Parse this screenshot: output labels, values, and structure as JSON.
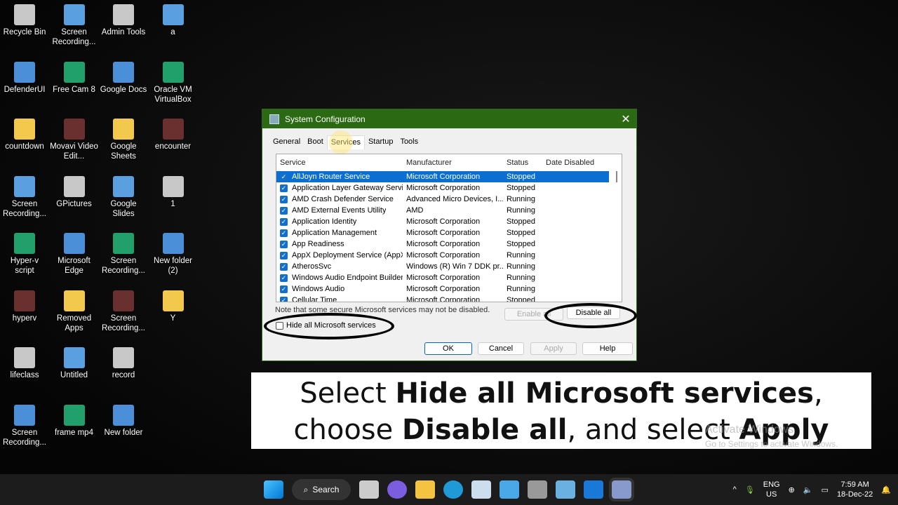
{
  "desktop": {
    "icons": [
      [
        "Recycle Bin",
        "DefenderUI",
        "countdown",
        "Screen Recording...",
        "Hyper-v script",
        "hyperv",
        "lifeclass",
        "Screen Recording..."
      ],
      [
        "Screen Recording...",
        "Free Cam 8",
        "Movavi Video Edit...",
        "GPictures",
        "Microsoft Edge",
        "Removed Apps",
        "Untitled",
        "frame mp4"
      ],
      [
        "Admin Tools",
        "Google Docs",
        "Google Sheets",
        "Google Slides",
        "Screen Recording...",
        "Screen Recording...",
        "record",
        "New folder"
      ],
      [
        "a",
        "Oracle VM VirtualBox",
        "encounter",
        "1",
        "New folder (2)",
        "Y"
      ]
    ]
  },
  "dialog": {
    "title": "System Configuration",
    "tabs": [
      "General",
      "Boot",
      "Services",
      "Startup",
      "Tools"
    ],
    "active_tab": "Services",
    "columns": [
      "Service",
      "Manufacturer",
      "Status",
      "Date Disabled"
    ],
    "rows": [
      {
        "service": "AllJoyn Router Service",
        "manufacturer": "Microsoft Corporation",
        "status": "Stopped",
        "checked": true,
        "selected": true
      },
      {
        "service": "Application Layer Gateway Service",
        "manufacturer": "Microsoft Corporation",
        "status": "Stopped",
        "checked": true
      },
      {
        "service": "AMD Crash Defender Service",
        "manufacturer": "Advanced Micro Devices, I...",
        "status": "Running",
        "checked": true
      },
      {
        "service": "AMD External Events Utility",
        "manufacturer": "AMD",
        "status": "Running",
        "checked": true
      },
      {
        "service": "Application Identity",
        "manufacturer": "Microsoft Corporation",
        "status": "Stopped",
        "checked": true
      },
      {
        "service": "Application Management",
        "manufacturer": "Microsoft Corporation",
        "status": "Stopped",
        "checked": true
      },
      {
        "service": "App Readiness",
        "manufacturer": "Microsoft Corporation",
        "status": "Stopped",
        "checked": true
      },
      {
        "service": "AppX Deployment Service (AppX...",
        "manufacturer": "Microsoft Corporation",
        "status": "Running",
        "checked": true
      },
      {
        "service": "AtherosSvc",
        "manufacturer": "Windows (R) Win 7 DDK pr...",
        "status": "Running",
        "checked": true
      },
      {
        "service": "Windows Audio Endpoint Builder",
        "manufacturer": "Microsoft Corporation",
        "status": "Running",
        "checked": true
      },
      {
        "service": "Windows Audio",
        "manufacturer": "Microsoft Corporation",
        "status": "Running",
        "checked": true
      },
      {
        "service": "Cellular Time",
        "manufacturer": "Microsoft Corporation",
        "status": "Stopped",
        "checked": true
      }
    ],
    "note": "Note that some secure Microsoft services may not be disabled.",
    "hide_ms_label": "Hide all Microsoft services",
    "hide_ms_checked": false,
    "enable_all": "Enable all",
    "disable_all": "Disable all",
    "ok": "OK",
    "cancel": "Cancel",
    "apply": "Apply",
    "help": "Help"
  },
  "caption": {
    "l1a": "Select ",
    "l1b": "Hide all Microsoft services",
    "l1c": ",",
    "l2a": "choose ",
    "l2b": "Disable all",
    "l2c": ", and select ",
    "l2d": "Apply"
  },
  "watermark": {
    "title": "Activate Windows",
    "sub": "Go to Settings to activate Windows."
  },
  "taskbar": {
    "search": "Search",
    "lang1": "ENG",
    "lang2": "US",
    "time": "7:59 AM",
    "date": "18-Dec-22"
  }
}
